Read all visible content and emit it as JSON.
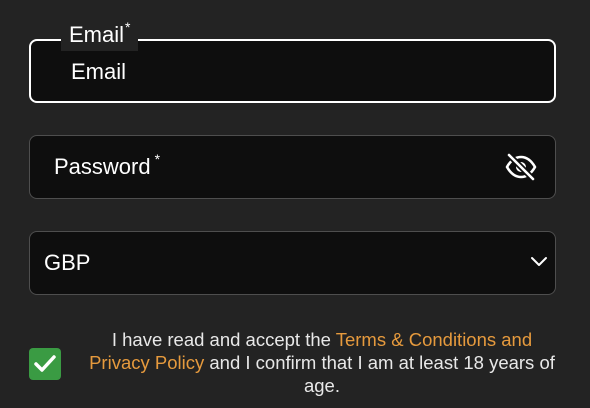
{
  "email": {
    "label": "Email",
    "required_marker": "*",
    "value": "Email"
  },
  "password": {
    "placeholder": "Password",
    "required_marker": "*",
    "visibility_icon": "eye-off-icon"
  },
  "currency": {
    "selected": "GBP",
    "icon": "chevron-down-icon"
  },
  "consent": {
    "checked": true,
    "text_before": "I have read and accept the ",
    "link_text": "Terms & Conditions and Privacy Policy",
    "text_after": " and I confirm that I am at least 18 years of age."
  },
  "colors": {
    "background": "#232323",
    "field_background": "#0e0e0e",
    "link": "#e69a3d",
    "checkbox": "#3a9b43"
  }
}
